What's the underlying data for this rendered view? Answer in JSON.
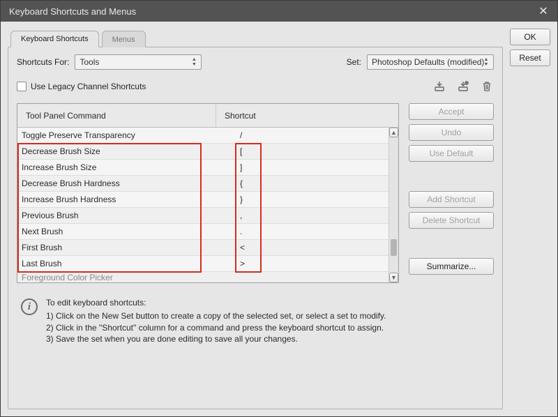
{
  "window": {
    "title": "Keyboard Shortcuts and Menus"
  },
  "tabs": {
    "shortcuts": "Keyboard Shortcuts",
    "menus": "Menus"
  },
  "topRow": {
    "shortcutsForLabel": "Shortcuts For:",
    "shortcutsForValue": "Tools",
    "setLabel": "Set:",
    "setValue": "Photoshop Defaults (modified)"
  },
  "legacy": {
    "label": "Use Legacy Channel Shortcuts"
  },
  "table": {
    "header": {
      "col1": "Tool Panel Command",
      "col2": "Shortcut"
    },
    "rows": [
      {
        "name": "Toggle Preserve Transparency",
        "key": "/"
      },
      {
        "name": "Decrease Brush Size",
        "key": "["
      },
      {
        "name": "Increase Brush Size",
        "key": "]"
      },
      {
        "name": "Decrease Brush Hardness",
        "key": "{"
      },
      {
        "name": "Increase Brush Hardness",
        "key": "}"
      },
      {
        "name": "Previous Brush",
        "key": ","
      },
      {
        "name": "Next Brush",
        "key": "."
      },
      {
        "name": "First Brush",
        "key": "<"
      },
      {
        "name": "Last Brush",
        "key": ">"
      },
      {
        "name": "Foreground Color Picker",
        "key": ""
      }
    ]
  },
  "info": {
    "heading": "To edit keyboard shortcuts:",
    "line1": "1) Click on the New Set button to create a copy of the selected set, or select a set to modify.",
    "line2": "2) Click in the \"Shortcut\" column for a command and press the keyboard shortcut to assign.",
    "line3": "3) Save the set when you are done editing to save all your changes."
  },
  "buttons": {
    "ok": "OK",
    "reset": "Reset",
    "accept": "Accept",
    "undo": "Undo",
    "useDefault": "Use Default",
    "addShortcut": "Add Shortcut",
    "deleteShortcut": "Delete Shortcut",
    "summarize": "Summarize..."
  }
}
